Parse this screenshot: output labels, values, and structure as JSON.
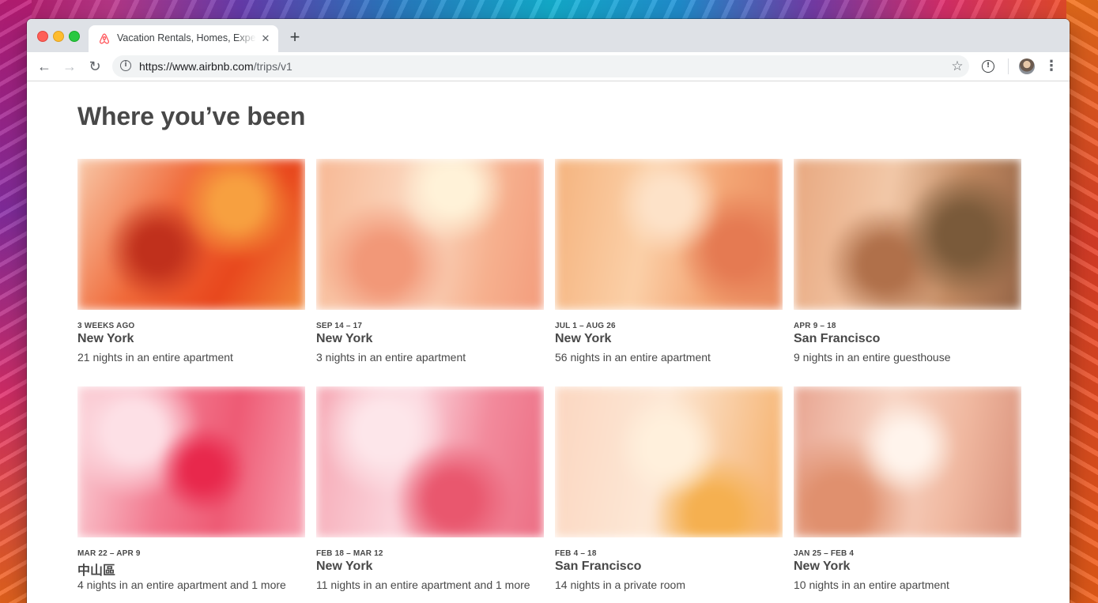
{
  "browser": {
    "tab_title": "Vacation Rentals, Homes, Experiences & Places",
    "tab_close_glyph": "✕",
    "new_tab_glyph": "+",
    "url_host": "https://www.airbnb.com",
    "url_path": "/trips/v1",
    "icons": {
      "back": "←",
      "forward": "→",
      "reload": "↻",
      "site_info": "i",
      "bookmark": "☆",
      "extension": "!",
      "menu": "⋮"
    }
  },
  "page": {
    "title": "Where you’ve been",
    "brand_color": "#ff5a5f",
    "text_color": "#484848"
  },
  "trips": [
    {
      "date": "3 WEEKS AGO",
      "city": "New York",
      "details": "21 nights in an entire apartment"
    },
    {
      "date": "SEP 14 – 17",
      "city": "New York",
      "details": "3 nights in an entire apartment"
    },
    {
      "date": "JUL 1 – AUG 26",
      "city": "New York",
      "details": "56 nights in an entire apartment"
    },
    {
      "date": "APR 9 – 18",
      "city": "San Francisco",
      "details": "9 nights in an entire guesthouse"
    },
    {
      "date": "MAR 22 – APR 9",
      "city": "中山區",
      "details": "4 nights in an entire apartment and 1 more"
    },
    {
      "date": "FEB 18 – MAR 12",
      "city": "New York",
      "details": "11 nights in an entire apartment and 1 more"
    },
    {
      "date": "FEB 4 – 18",
      "city": "San Francisco",
      "details": "14 nights in a private room"
    },
    {
      "date": "JAN 25 – FEB 4",
      "city": "New York",
      "details": "10 nights in an entire apartment"
    }
  ]
}
